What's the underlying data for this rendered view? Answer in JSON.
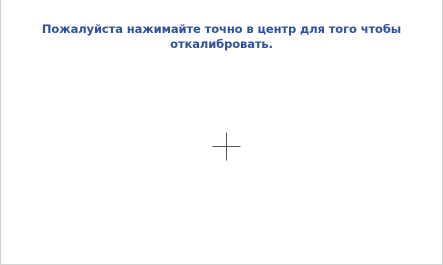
{
  "calibration": {
    "instruction_text": "Пожалуйста нажимайте точно в центр для того чтобы откалибровать.",
    "target_icon": "crosshair-icon",
    "colors": {
      "instruction_text": "#2f4f9f",
      "crosshair": "#555555",
      "background": "#ffffff"
    }
  }
}
